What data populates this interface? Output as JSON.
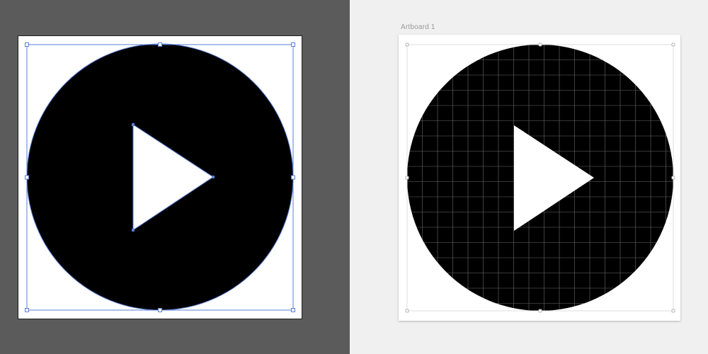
{
  "left_panel": {
    "app": "illustrator",
    "background_color": "#5b5b5b",
    "selection_color": "#5a7fd6",
    "icon": "play-icon"
  },
  "right_panel": {
    "app": "sketch",
    "artboard_label": "Artboard 1",
    "background_color": "#f0f0f0",
    "grid_color": "#6a6a6a",
    "icon": "play-icon"
  }
}
